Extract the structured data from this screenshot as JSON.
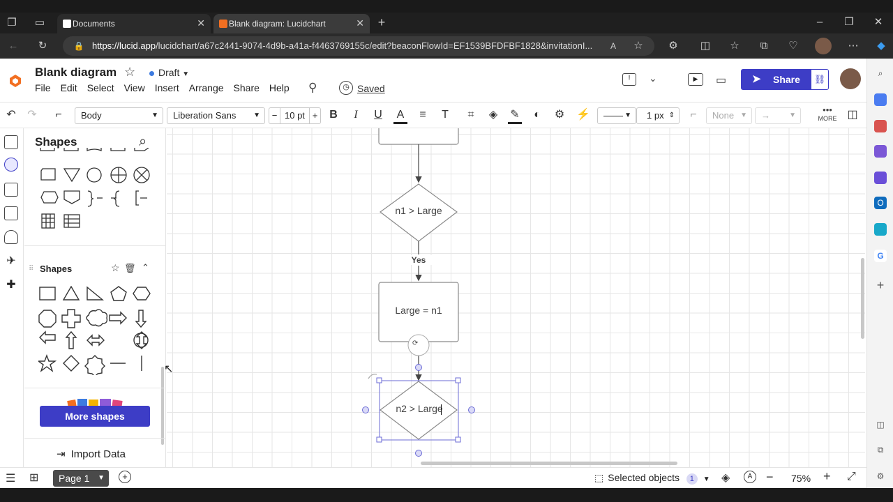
{
  "browser": {
    "tabs": [
      {
        "title": "Documents",
        "active": false
      },
      {
        "title": "Blank diagram: Lucidchart",
        "active": true
      }
    ],
    "url_host": "https://lucid.app",
    "url_path": "/lucidchart/a67c2441-9074-4d9b-a41a-f4463769155c/edit?beaconFlowId=EF1539BFDFBF1828&invitationI..."
  },
  "header": {
    "title": "Blank diagram",
    "status": "Draft",
    "saved": "Saved",
    "share": "Share",
    "menu": [
      "File",
      "Edit",
      "Select",
      "View",
      "Insert",
      "Arrange",
      "Share",
      "Help"
    ]
  },
  "toolbar": {
    "style": "Body",
    "font": "Liberation Sans",
    "font_size": "10 pt",
    "bold": "B",
    "italic": "I",
    "underline": "U",
    "line_width": "1 px",
    "arrow_none": "None",
    "more": "MORE"
  },
  "panel": {
    "title": "Shapes",
    "section_title": "Shapes",
    "more_shapes": "More shapes",
    "import_data": "Import Data"
  },
  "diagram": {
    "decision1": "n1 > Large",
    "yes_label": "Yes",
    "process1": "Large = n1",
    "decision2": "n2 > Large"
  },
  "bottom": {
    "page": "Page 1",
    "selected": "Selected objects",
    "selected_count": "1",
    "zoom": "75%"
  },
  "colors": {
    "accent": "#3d3dc6",
    "brand_orange": "#f26f21"
  }
}
